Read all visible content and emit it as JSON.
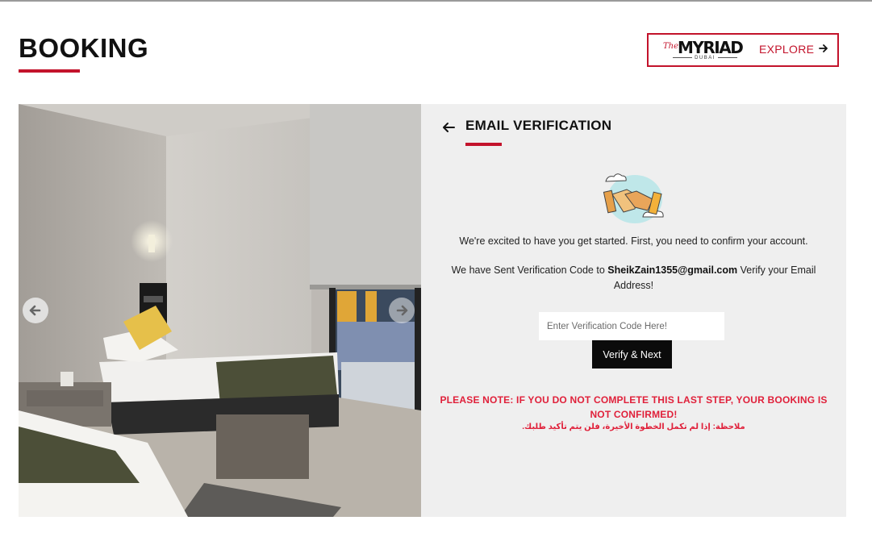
{
  "header": {
    "title": "BOOKING",
    "logo": {
      "the": "The",
      "name": "MYRIAD",
      "sub": "DUBAI"
    },
    "explore_label": "EXPLORE"
  },
  "carousel": {
    "prev_icon": "arrow-left-circle-icon",
    "next_icon": "arrow-right-circle-icon",
    "photo": "dorm-room-photo"
  },
  "verification": {
    "title": "EMAIL VERIFICATION",
    "intro": "We're excited to have you get started. First, you need to confirm your account.",
    "sent_prefix": "We have Sent Verification Code to ",
    "email": "SheikZain1355@gmail.com",
    "sent_suffix": " Verify your Email Address!",
    "input_placeholder": "Enter Verification Code Here!",
    "button_label": "Verify & Next",
    "note_en": "PLEASE NOTE: IF YOU DO NOT COMPLETE THIS LAST STEP, YOUR BOOKING IS NOT CONFIRMED!",
    "note_ar": "ملاحظة: إذا لم تكمل الخطوة الأخيرة، فلن يتم تأكيد طلبك."
  },
  "colors": {
    "accent": "#c3132b",
    "note": "#e0203a",
    "panel_bg": "#efefef",
    "button_bg": "#0b0b0b"
  }
}
